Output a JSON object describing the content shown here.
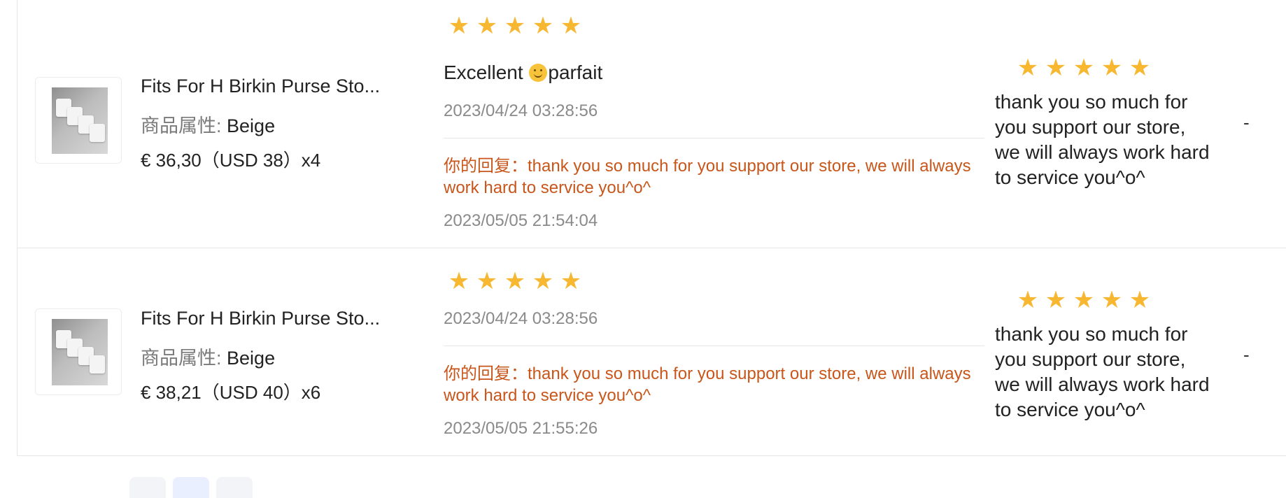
{
  "reviews": [
    {
      "product": {
        "title": "Fits For H Birkin Purse Sto...",
        "attr_label": "商品属性:",
        "attr_value": "Beige",
        "price": "€ 36,30（USD  38）x4"
      },
      "rating": 5,
      "review_text": "Excellent ",
      "review_emoji": "smiling-face-icon",
      "review_text_after": "parfait",
      "review_date": "2023/04/24 03:28:56",
      "reply": "你的回复：thank you so much for you support our store, we will always work hard to service you^o^",
      "reply_date": "2023/05/05 21:54:04",
      "seller_rating": 5,
      "seller_text": "thank you so much for you support our store, we will always work hard to service you^o^",
      "extra": "-"
    },
    {
      "product": {
        "title": "Fits For H Birkin Purse Sto...",
        "attr_label": "商品属性:",
        "attr_value": "Beige",
        "price": "€ 38,21（USD  40）x6"
      },
      "rating": 5,
      "review_date": "2023/04/24 03:28:56",
      "reply": "你的回复：thank you so much for you support our store, we will always work hard to service you^o^",
      "reply_date": "2023/05/05 21:55:26",
      "seller_rating": 5,
      "seller_text": "thank you so much for you support our store, we will always work hard to service you^o^",
      "extra": "-"
    }
  ],
  "colors": {
    "star": "#f7b731",
    "reply": "#c8561b",
    "muted": "#8a8a8a"
  }
}
